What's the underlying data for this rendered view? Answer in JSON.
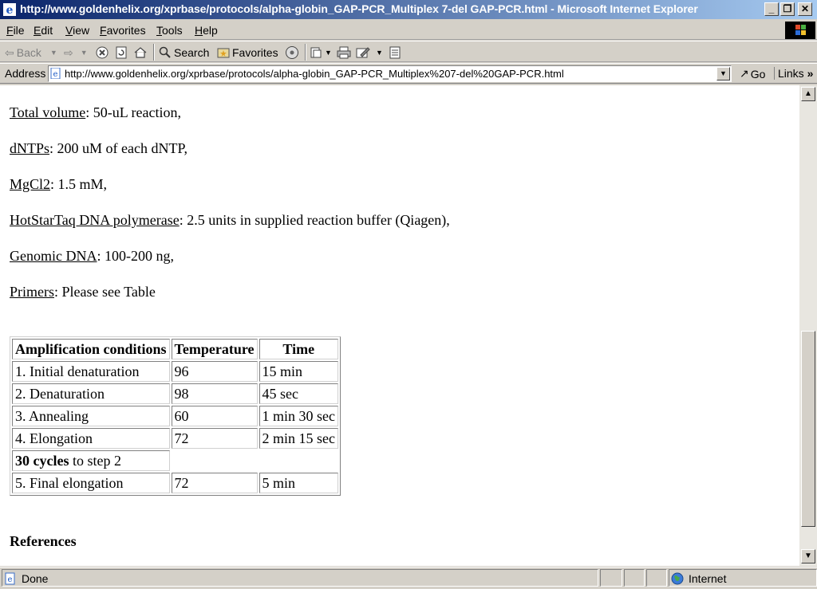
{
  "window": {
    "title": "http://www.goldenhelix.org/xprbase/protocols/alpha-globin_GAP-PCR_Multiplex 7-del GAP-PCR.html - Microsoft Internet Explorer"
  },
  "menu": {
    "items": [
      {
        "first": "F",
        "rest": "ile"
      },
      {
        "first": "E",
        "rest": "dit"
      },
      {
        "first": "V",
        "rest": "iew"
      },
      {
        "first": "F",
        "rest": "avorites"
      },
      {
        "first": "T",
        "rest": "ools"
      },
      {
        "first": "H",
        "rest": "elp"
      }
    ]
  },
  "toolbar": {
    "back_label": "Back",
    "search_label": "Search",
    "favorites_label": "Favorites"
  },
  "address": {
    "label": "Address",
    "url": "http://www.goldenhelix.org/xprbase/protocols/alpha-globin_GAP-PCR_Multiplex%207-del%20GAP-PCR.html",
    "go_label": "Go",
    "links_label": "Links"
  },
  "content": {
    "params": [
      {
        "label": "Total volume",
        "value": ": 50-uL reaction,"
      },
      {
        "label": "dNTPs",
        "value": ": 200 uM of each dNTP,"
      },
      {
        "label": "MgCl2",
        "value": ": 1.5 mM,"
      },
      {
        "label": "HotStarTaq DNA polymerase",
        "value": ": 2.5 units in supplied reaction buffer (Qiagen),"
      },
      {
        "label": "Genomic DNA",
        "value": ": 100-200 ng,"
      },
      {
        "label": "Primers",
        "value": ": Please see Table"
      }
    ],
    "table": {
      "headers": [
        "Amplification conditions",
        "Temperature",
        "Time"
      ],
      "rows": [
        [
          "1. Initial denaturation",
          "96",
          "15 min"
        ],
        [
          "2. Denaturation",
          "98",
          "45 sec"
        ],
        [
          "3. Annealing",
          "60",
          "1 min 30 sec"
        ],
        [
          "4. Elongation",
          "72",
          "2 min 15 sec"
        ]
      ],
      "cycles_bold": "30 cycles",
      "cycles_rest": " to step 2",
      "final_row": [
        "5. Final elongation",
        "72",
        "5 min"
      ]
    },
    "references_heading": "References"
  },
  "status": {
    "text": "Done",
    "zone": "Internet"
  }
}
